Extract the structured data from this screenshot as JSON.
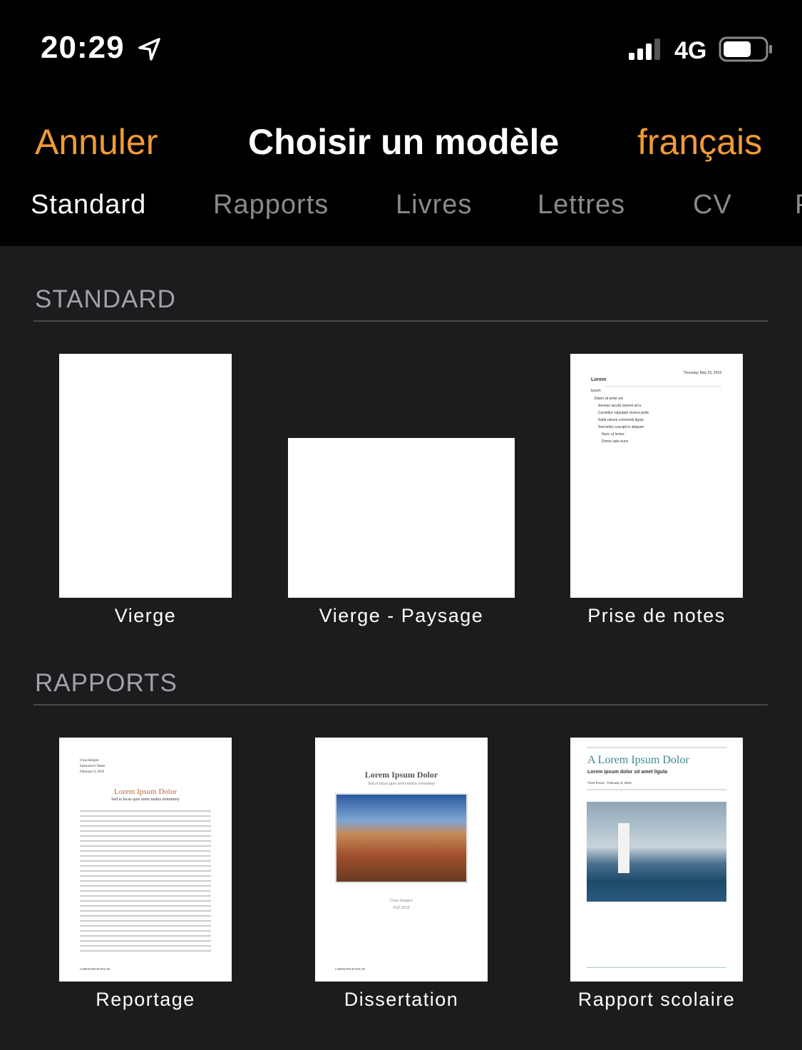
{
  "status": {
    "time": "20:29",
    "network": "4G",
    "battery_level": 0.7
  },
  "nav": {
    "cancel": "Annuler",
    "title": "Choisir un modèle",
    "language": "français",
    "accent": "#f09a37"
  },
  "tabs": [
    {
      "label": "Standard",
      "active": true
    },
    {
      "label": "Rapports"
    },
    {
      "label": "Livres"
    },
    {
      "label": "Lettres"
    },
    {
      "label": "CV"
    },
    {
      "label": "P"
    }
  ],
  "sections": [
    {
      "title": "STANDARD",
      "templates": [
        {
          "label": "Vierge"
        },
        {
          "label": "Vierge - Paysage"
        },
        {
          "label": "Prise de notes",
          "preview": {
            "date": "Thursday, May 23, 2019",
            "heading": "Lorem",
            "sub": "Ipsum",
            "items": [
              "Etiam sit amet est",
              "Aenean iaculis laoreet arcu",
              "Curabitur vulputate viverra pede",
              "Nulla rutrum commodo ligula",
              "Sed tellus suscipit in aliquam",
              "Nunc ut lectus",
              "Donec quis nunc"
            ]
          }
        }
      ]
    },
    {
      "title": "RAPPORTS",
      "templates": [
        {
          "label": "Reportage",
          "preview": {
            "meta": [
              "Urna Semper",
              "Instructor's Name",
              "February 8, 2019"
            ],
            "title": "Lorem Ipsum Dolor",
            "subtitle": "Sed et lacus quis enim mattis nonummy",
            "footer": "LOREM IPSUM DOLOR"
          }
        },
        {
          "label": "Dissertation",
          "preview": {
            "title": "Lorem Ipsum Dolor",
            "subtitle": "Sed et lacus quis enim mattis nonummy",
            "author": "Urna Semper",
            "date": "Fall 2019",
            "footer": "LOREM IPSUM DOLOR"
          }
        },
        {
          "label": "Rapport scolaire",
          "preview": {
            "title": "A Lorem Ipsum Dolor",
            "subtitle": "Lorem ipsum dolor sit amet ligula",
            "byline": "Trent Pruca - February 8, 2019"
          }
        }
      ]
    }
  ]
}
